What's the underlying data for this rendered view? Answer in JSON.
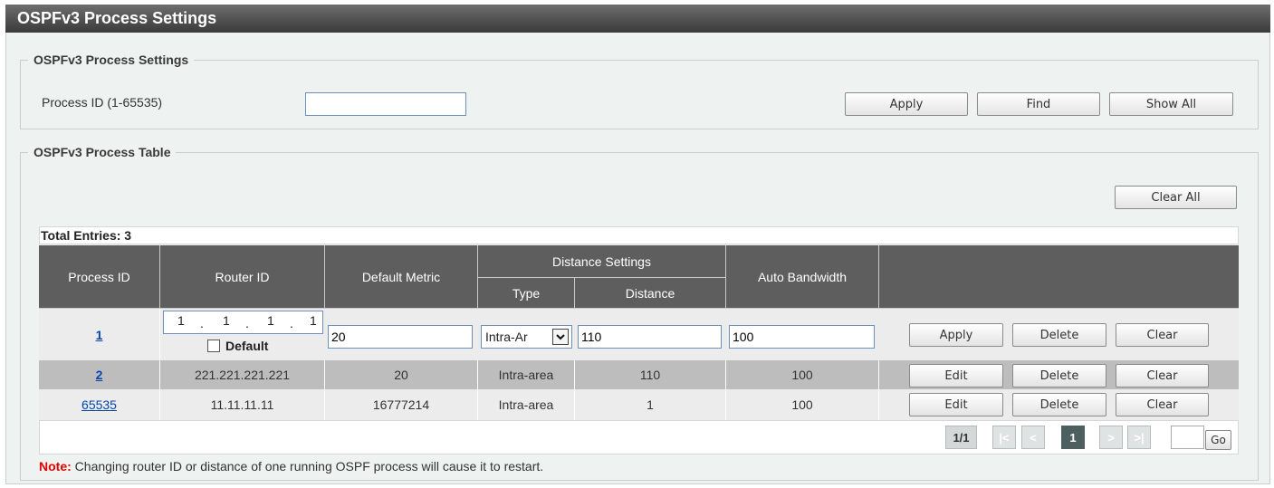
{
  "page": {
    "title": "OSPFv3 Process Settings"
  },
  "settings": {
    "legend": "OSPFv3 Process Settings",
    "process_id_label": "Process ID (1-65535)",
    "process_id_value": "",
    "apply_label": "Apply",
    "find_label": "Find",
    "show_all_label": "Show All"
  },
  "table_section": {
    "legend": "OSPFv3 Process Table",
    "clear_all_label": "Clear All",
    "total_entries": "Total Entries: 3",
    "headers": {
      "process_id": "Process ID",
      "router_id": "Router ID",
      "default_metric": "Default Metric",
      "distance_settings": "Distance Settings",
      "type": "Type",
      "distance": "Distance",
      "auto_bandwidth": "Auto Bandwidth"
    },
    "edit_row": {
      "process_id": "1",
      "router_id_octets": [
        "1",
        "1",
        "1",
        "1"
      ],
      "router_id_dot": ".",
      "default_label": "Default",
      "default_checked": false,
      "default_metric": "20",
      "type_selected": "Intra-Ar",
      "distance": "110",
      "auto_bandwidth": "100",
      "apply_label": "Apply",
      "delete_label": "Delete",
      "clear_label": "Clear"
    },
    "rows": [
      {
        "process_id": "2",
        "router_id": "221.221.221.221",
        "default_metric": "20",
        "type": "Intra-area",
        "distance": "110",
        "auto_bandwidth": "100",
        "edit_label": "Edit",
        "delete_label": "Delete",
        "clear_label": "Clear"
      },
      {
        "process_id": "65535",
        "router_id": "11.11.11.11",
        "default_metric": "16777214",
        "type": "Intra-area",
        "distance": "1",
        "auto_bandwidth": "100",
        "edit_label": "Edit",
        "delete_label": "Delete",
        "clear_label": "Clear"
      }
    ],
    "pagination": {
      "page_info": "1/1",
      "first": "|<",
      "prev": "<",
      "current": "1",
      "next": ">",
      "last": ">|",
      "go_label": "Go",
      "go_value": ""
    },
    "note_prefix": "Note:",
    "note_text": " Changing router ID or distance of one running OSPF process will cause it to restart."
  },
  "colors": {
    "header_bg": "#5e5e5e",
    "row_alt_bg": "#bdbdbd",
    "link": "#0645ad",
    "note": "#e00000"
  }
}
